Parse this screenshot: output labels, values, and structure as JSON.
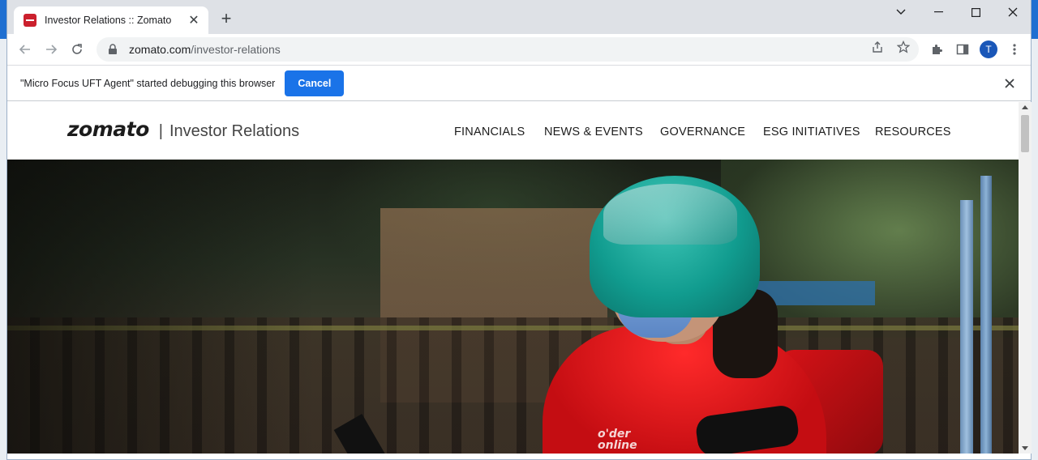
{
  "browser": {
    "tab": {
      "title": "Investor Relations :: Zomato",
      "favicon": "zomato-favicon",
      "close_glyph": "✕"
    },
    "new_tab_glyph": "+",
    "window_controls": [
      "chevron-down-icon",
      "minimize-icon",
      "maximize-icon",
      "close-icon"
    ],
    "url": {
      "host": "zomato.com",
      "path": "/investor-relations"
    },
    "profile_initial": "T",
    "accent_color": "#1a73e8"
  },
  "infobar": {
    "message": "\"Micro Focus UFT Agent\" started debugging this browser",
    "cancel_label": "Cancel"
  },
  "site": {
    "brand": "zomato",
    "separator": "|",
    "section_title": "Investor Relations",
    "nav": [
      "FINANCIALS",
      "NEWS & EVENTS",
      "GOVERNANCE",
      "ESG INITIATIVES",
      "RESOURCES"
    ],
    "hero_shirt_text": "o'der\nonline",
    "brand_color": "#cb202d"
  }
}
